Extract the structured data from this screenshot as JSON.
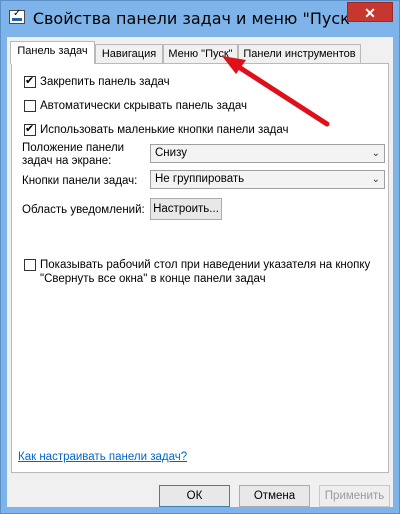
{
  "window": {
    "title": "Свойства панели задач и меню \"Пуск\"",
    "close_label": "✕",
    "accent_color": "#7eb4ea"
  },
  "tabs": [
    {
      "label": "Панель задач",
      "active": true
    },
    {
      "label": "Навигация",
      "active": false
    },
    {
      "label": "Меню \"Пуск\"",
      "active": false
    },
    {
      "label": "Панели инструментов",
      "active": false
    }
  ],
  "options": {
    "lock_taskbar": {
      "label": "Закрепить панель задач",
      "checked": true
    },
    "auto_hide": {
      "label": "Автоматически скрывать панель задач",
      "checked": false
    },
    "small_buttons": {
      "label": "Использовать маленькие кнопки панели задач",
      "checked": true
    }
  },
  "position": {
    "label_line1": "Положение панели",
    "label_line2": "задач на экране:",
    "value": "Снизу"
  },
  "buttons_grouping": {
    "label": "Кнопки панели задач:",
    "value": "Не группировать"
  },
  "notification": {
    "label": "Область уведомлений:",
    "button": "Настроить..."
  },
  "peek": {
    "line1": "Показывать рабочий стол при наведении указателя на кнопку",
    "line2": "\"Свернуть все окна\" в конце панели задач",
    "checked": false
  },
  "help_link": "Как настраивать панели задач?",
  "footer": {
    "ok": "ОК",
    "cancel": "Отмена",
    "apply": "Применить"
  },
  "annotation_arrow_color": "#e0101a"
}
